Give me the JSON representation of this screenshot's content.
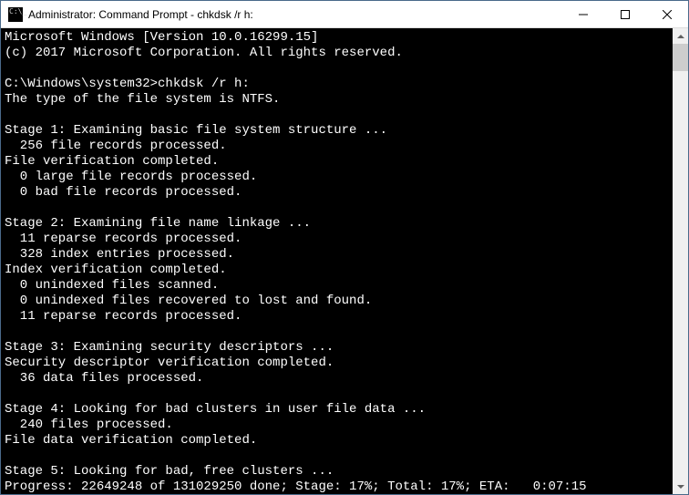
{
  "window": {
    "title": "Administrator: Command Prompt - chkdsk  /r h:"
  },
  "console": {
    "header": [
      "Microsoft Windows [Version 10.0.16299.15]",
      "(c) 2017 Microsoft Corporation. All rights reserved.",
      ""
    ],
    "prompt": "C:\\Windows\\system32>",
    "command": "chkdsk /r h:",
    "fsline": "The type of the file system is NTFS.",
    "stages": [
      {
        "title": "Stage 1: Examining basic file system structure ...",
        "lines": [
          "  256 file records processed.",
          "File verification completed.",
          "  0 large file records processed.",
          "  0 bad file records processed."
        ]
      },
      {
        "title": "Stage 2: Examining file name linkage ...",
        "lines": [
          "  11 reparse records processed.",
          "  328 index entries processed.",
          "Index verification completed.",
          "  0 unindexed files scanned.",
          "  0 unindexed files recovered to lost and found.",
          "  11 reparse records processed."
        ]
      },
      {
        "title": "Stage 3: Examining security descriptors ...",
        "lines": [
          "Security descriptor verification completed.",
          "  36 data files processed."
        ]
      },
      {
        "title": "Stage 4: Looking for bad clusters in user file data ...",
        "lines": [
          "  240 files processed.",
          "File data verification completed."
        ]
      },
      {
        "title": "Stage 5: Looking for bad, free clusters ...",
        "lines": [
          "Progress: 22649248 of 131029250 done; Stage: 17%; Total: 17%; ETA:   0:07:15"
        ]
      }
    ]
  }
}
